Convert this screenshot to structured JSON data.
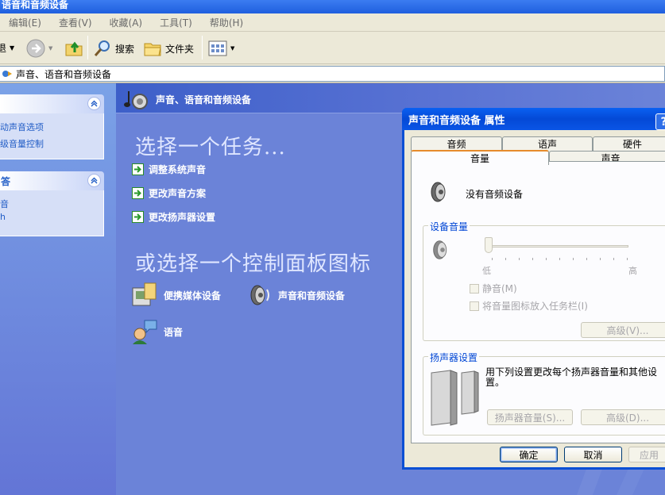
{
  "window": {
    "title": "语音和音频设备"
  },
  "menu": [
    {
      "label": "编辑(E)"
    },
    {
      "label": "查看(V)"
    },
    {
      "label": "收藏(A)"
    },
    {
      "label": "工具(T)"
    },
    {
      "label": "帮助(H)"
    }
  ],
  "toolbar": {
    "back_fragment": "退",
    "search_label": "搜索",
    "folders_label": "文件夹"
  },
  "address": {
    "path": "声音、语音和音频设备"
  },
  "left_panel": {
    "section1": {
      "title": "",
      "links": [
        "动声音选项",
        "级音量控制"
      ]
    },
    "section2": {
      "title": "答",
      "links": [
        "音",
        "h"
      ]
    }
  },
  "main": {
    "header_title": "声音、语音和音频设备",
    "pick_task": "选择一个任务...",
    "tasks": [
      "调整系统声音",
      "更改声音方案",
      "更改扬声器设置"
    ],
    "pick_icon": "或选择一个控制面板图标",
    "icons": [
      {
        "label": "便携媒体设备",
        "icon": "portable-media-icon"
      },
      {
        "label": "声音和音频设备",
        "icon": "speaker-icon"
      },
      {
        "label": "语音",
        "icon": "speech-icon"
      }
    ]
  },
  "dialog": {
    "title": "声音和音频设备 属性",
    "help": "?",
    "tabs_row1": [
      "音频",
      "语声",
      "硬件"
    ],
    "tabs_row2": [
      "音量",
      "声音"
    ],
    "no_device": "没有音频设备",
    "device_volume_label": "设备音量",
    "slider_low": "低",
    "slider_high": "高",
    "mute_label": "静音(M)",
    "tray_label": "将音量图标放入任务栏(I)",
    "advanced_btn": "高级(V)...",
    "speaker_group_label": "扬声器设置",
    "speaker_desc": "用下列设置更改每个扬声器音量和其他设置。",
    "speaker_volume_btn": "扬声器音量(S)...",
    "speaker_advanced_btn": "高级(D)...",
    "ok": "确定",
    "cancel": "取消",
    "apply": "应用",
    "volume_level": 0
  }
}
